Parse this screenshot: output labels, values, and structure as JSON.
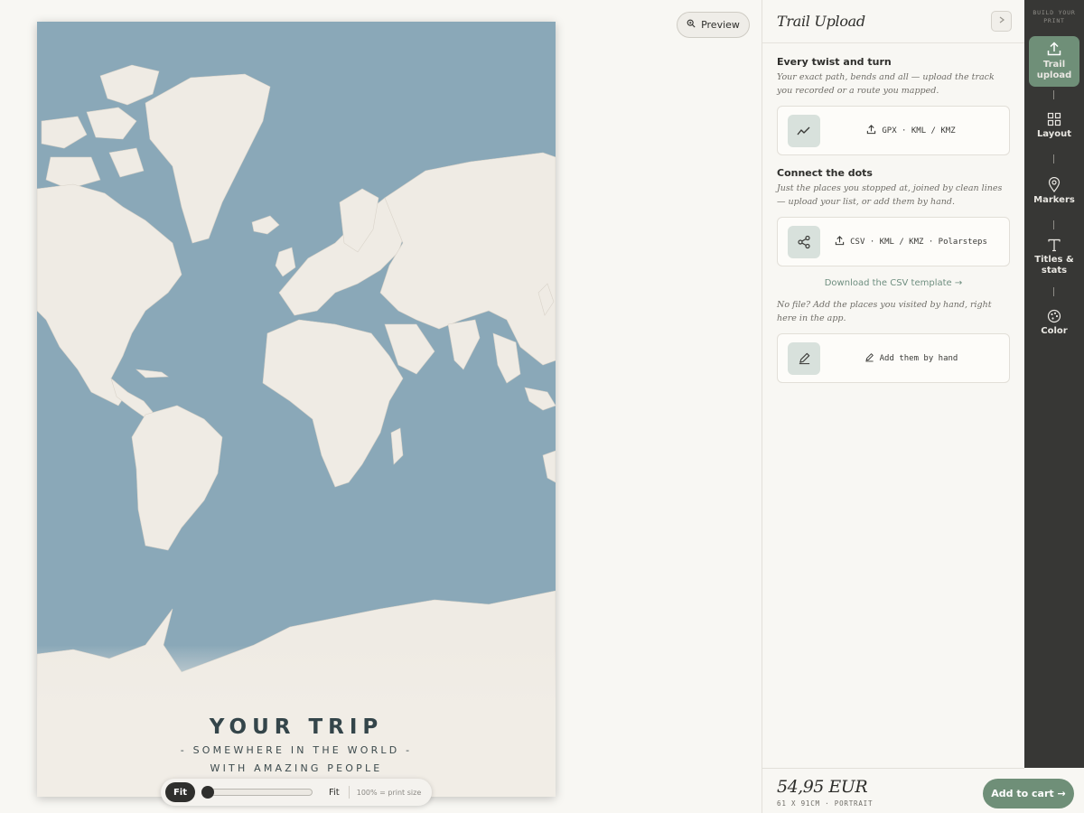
{
  "preview": {
    "label": "Preview"
  },
  "poster": {
    "title": "YOUR TRIP",
    "subtitle_1": "- SOMEWHERE IN THE WORLD -",
    "subtitle_2": "WITH AMAZING PEOPLE",
    "colors": {
      "ocean": "#8aa8b8",
      "land": "#efebe4",
      "paper": "#f1ede6",
      "text": "#34454a"
    }
  },
  "zoom": {
    "fit_active_label": "Fit",
    "fit_label": "Fit",
    "note": "100% = print size",
    "level": 0
  },
  "panel": {
    "title": "Trail Upload",
    "collapse_icon": "chevron-right-icon",
    "sections": [
      {
        "heading": "Every twist and turn",
        "description": "Your exact path, bends and all — upload the track you recorded or a route you mapped.",
        "card_icon": "trend-line-icon",
        "card_label": "GPX · KML / KMZ"
      },
      {
        "heading": "Connect the dots",
        "description": "Just the places you stopped at, joined by clean lines — upload your list, or add them by hand.",
        "card_icon": "share-nodes-icon",
        "card_label": "CSV · KML / KMZ · Polarsteps"
      }
    ],
    "template_link": "Download the CSV template →",
    "manual_note": "No file? Add the places you visited by hand, right here in the app.",
    "manual_card": {
      "icon": "pencil-icon",
      "label": "Add them by hand"
    },
    "price": "54,95 EUR",
    "price_meta": "61 X 91CM · PORTRAIT",
    "cart_label": "Add to cart →",
    "accent": "#6f8f78"
  },
  "rail": {
    "caption_1": "BUILD YOUR",
    "caption_2": "PRINT",
    "items": [
      {
        "label_1": "Trail",
        "label_2": "upload",
        "icon": "upload-icon",
        "active": true
      },
      {
        "label_1": "Layout",
        "label_2": "",
        "icon": "grid-icon",
        "active": false
      },
      {
        "label_1": "Markers",
        "label_2": "",
        "icon": "map-pin-icon",
        "active": false
      },
      {
        "label_1": "Titles &",
        "label_2": "stats",
        "icon": "text-icon",
        "active": false
      },
      {
        "label_1": "Color",
        "label_2": "",
        "icon": "palette-icon",
        "active": false
      }
    ]
  }
}
